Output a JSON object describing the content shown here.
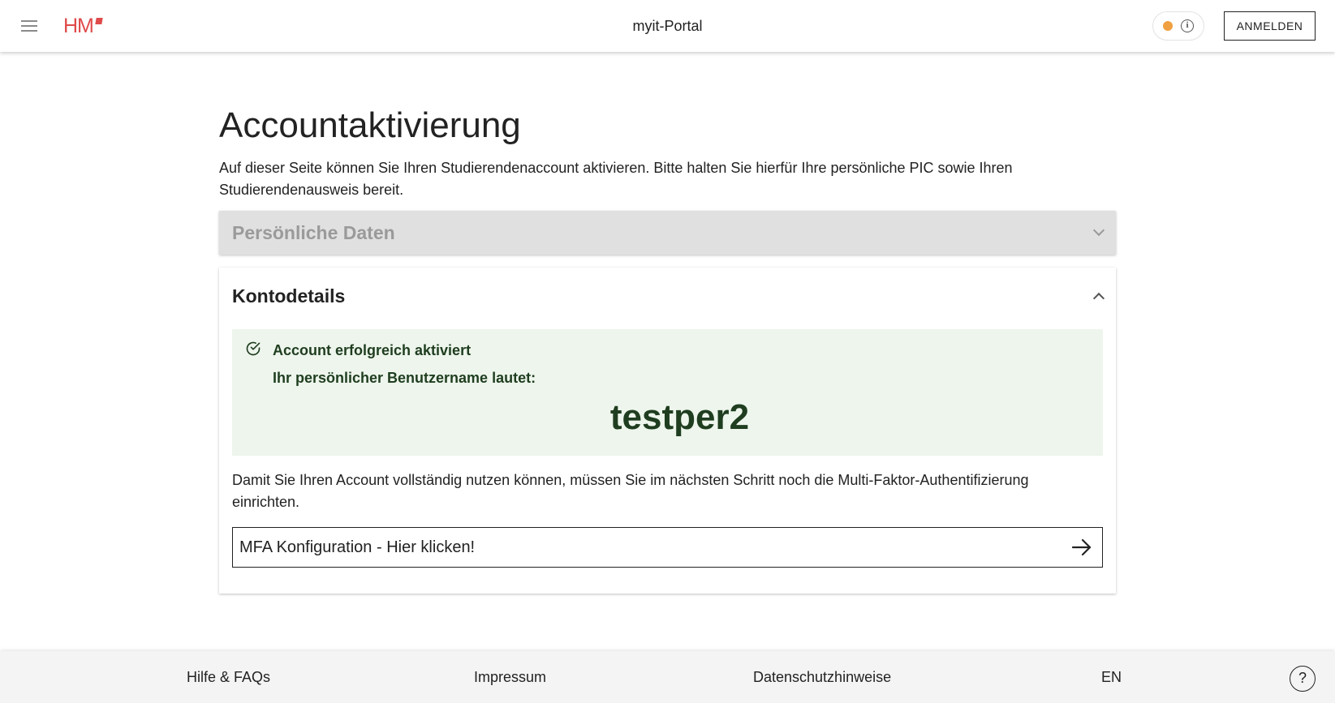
{
  "header": {
    "logo_text": "HM",
    "app_title": "myit-Portal",
    "login_label": "ANMELDEN",
    "status_color": "#f0a040"
  },
  "main": {
    "title": "Accountaktivierung",
    "intro": "Auf dieser Seite können Sie Ihren Studierendenaccount aktivieren. Bitte halten Sie hierfür Ihre persönliche PIC sowie Ihren Studierendenausweis bereit.",
    "section_personal": {
      "title": "Persönliche Daten",
      "state": "collapsed"
    },
    "section_account": {
      "title": "Kontodetails",
      "state": "expanded",
      "success_title": "Account erfolgreich aktiviert",
      "username_label": "Ihr persönlicher Benutzername lautet:",
      "username": "testper2",
      "mfa_note": "Damit Sie Ihren Account vollständig nutzen können, müssen Sie im nächsten Schritt noch die Multi-Faktor-Authentifizierung einrichten.",
      "mfa_link": "MFA Konfiguration - Hier klicken!"
    }
  },
  "footer": {
    "links": [
      "Hilfe & FAQs",
      "Impressum",
      "Datenschutzhinweise",
      "EN"
    ],
    "help_symbol": "?"
  },
  "colors": {
    "brand": "#e04a4a",
    "success_bg": "#edf5ec",
    "success_text": "#1f3d1f"
  }
}
